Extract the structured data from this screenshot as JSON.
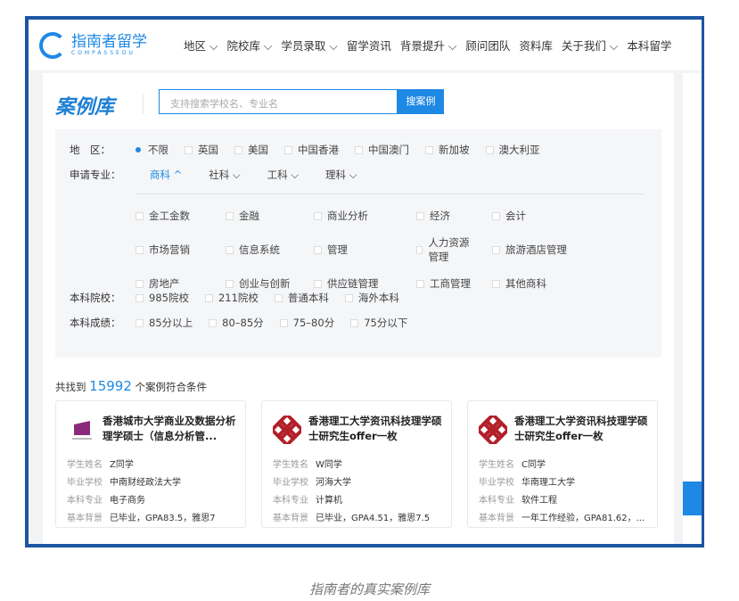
{
  "header": {
    "logo": "指南者留学",
    "logo_sub": "COMPASSEDU",
    "nav": [
      "地区 ⌵",
      "院校库 ⌵",
      "学员录取 ⌵",
      "留学资讯",
      "背景提升 ⌵",
      "顾问团队",
      "资料库",
      "关于我们 ⌵",
      "本科留学"
    ]
  },
  "page": {
    "title": "案例库",
    "search_placeholder": "支持搜索学校名、专业名",
    "search_button": "搜案例"
  },
  "filters": {
    "region_label": "地　区：",
    "regions": [
      "不限",
      "英国",
      "美国",
      "中国香港",
      "中国澳门",
      "新加坡",
      "澳大利亚"
    ],
    "major_label": "申请专业：",
    "major_groups": [
      "商科 ^",
      "社科 ⌵",
      "工科 ⌵",
      "理科 ⌵"
    ],
    "subjects": [
      "金工金数",
      "金融",
      "商业分析",
      "经济",
      "会计",
      "市场营销",
      "信息系统",
      "管理",
      "人力资源管理",
      "旅游酒店管理",
      "房地产",
      "创业与创新",
      "供应链管理",
      "工商管理",
      "其他商科"
    ],
    "school_label": "本科院校：",
    "schools": [
      "985院校",
      "211院校",
      "普通本科",
      "海外本科"
    ],
    "score_label": "本科成绩：",
    "scores": [
      "85分以上",
      "80–85分",
      "75–80分",
      "75分以下"
    ]
  },
  "results": {
    "prefix": "共找到",
    "count": "15992",
    "suffix": "个案例符合条件"
  },
  "cards": [
    {
      "title": "香港城市大学商业及数据分析理学硕士（信息分析管...",
      "logo": "CityU",
      "fields": [
        [
          "学生姓名",
          "Z同学"
        ],
        [
          "毕业学校",
          "中南财经政法大学"
        ],
        [
          "本科专业",
          "电子商务"
        ],
        [
          "基本背景",
          "已毕业，GPA83.5，雅思7"
        ]
      ]
    },
    {
      "title": "香港理工大学资讯科技理学硕士研究生offer一枚",
      "logo": "PolyU",
      "fields": [
        [
          "学生姓名",
          "W同学"
        ],
        [
          "毕业学校",
          "河海大学"
        ],
        [
          "本科专业",
          "计算机"
        ],
        [
          "基本背景",
          "已毕业，GPA4.51，雅思7.5"
        ]
      ]
    },
    {
      "title": "香港理工大学资讯科技理学硕士研究生offer一枚",
      "logo": "PolyU",
      "fields": [
        [
          "学生姓名",
          "C同学"
        ],
        [
          "毕业学校",
          "华南理工大学"
        ],
        [
          "本科专业",
          "软件工程"
        ],
        [
          "基本背景",
          "一年工作经验，GPA81.62，..."
        ]
      ]
    }
  ],
  "caption": "指南者的真实案例库"
}
